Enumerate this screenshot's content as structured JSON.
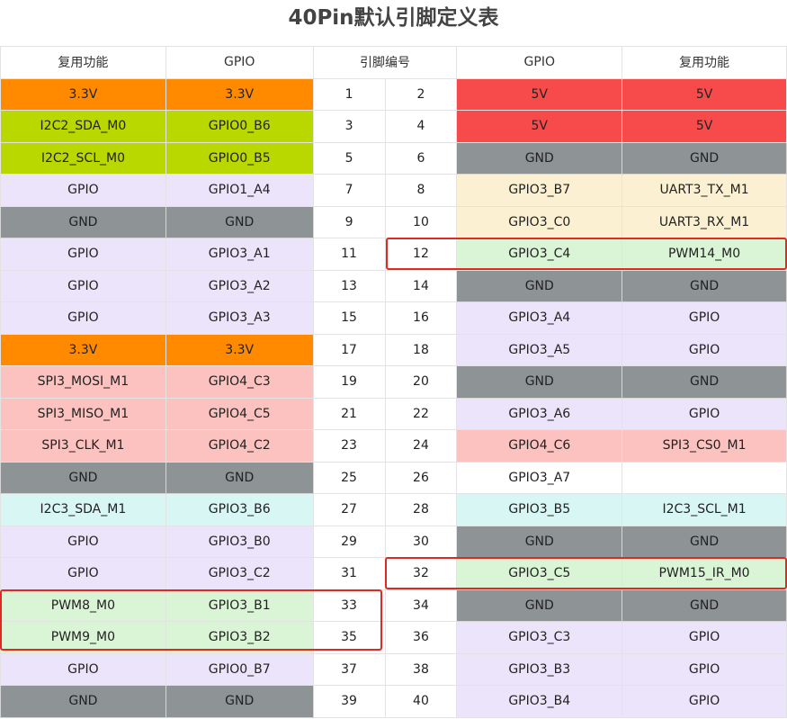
{
  "title": "40Pin默认引脚定义表",
  "headers": {
    "func_left": "复用功能",
    "gpio_left": "GPIO",
    "pin_no": "引脚编号",
    "gpio_right": "GPIO",
    "func_right": "复用功能"
  },
  "colors": {
    "orange": "#ff8a00",
    "green": "#b8d800",
    "red": "#f64b4a",
    "gray": "#8e9396",
    "lavender": "#ebe4fa",
    "cream": "#fbf1d2",
    "mint": "#daf5d5",
    "pink": "#fbc2bf",
    "cyan": "#d7f6f4",
    "white": "#ffffff",
    "highlight": "#e02a20"
  },
  "rows": [
    {
      "lf": "3.3V",
      "lg": "3.3V",
      "lc": "orange",
      "p1": "1",
      "p2": "2",
      "rg": "5V",
      "rf": "5V",
      "rc": "red"
    },
    {
      "lf": "I2C2_SDA_M0",
      "lg": "GPIO0_B6",
      "lc": "green",
      "p1": "3",
      "p2": "4",
      "rg": "5V",
      "rf": "5V",
      "rc": "red"
    },
    {
      "lf": "I2C2_SCL_M0",
      "lg": "GPIO0_B5",
      "lc": "green",
      "p1": "5",
      "p2": "6",
      "rg": "GND",
      "rf": "GND",
      "rc": "gray"
    },
    {
      "lf": "GPIO",
      "lg": "GPIO1_A4",
      "lc": "lavender",
      "p1": "7",
      "p2": "8",
      "rg": "GPIO3_B7",
      "rf": "UART3_TX_M1",
      "rc": "cream"
    },
    {
      "lf": "GND",
      "lg": "GND",
      "lc": "gray",
      "p1": "9",
      "p2": "10",
      "rg": "GPIO3_C0",
      "rf": "UART3_RX_M1",
      "rc": "cream"
    },
    {
      "lf": "GPIO",
      "lg": "GPIO3_A1",
      "lc": "lavender",
      "p1": "11",
      "p2": "12",
      "rg": "GPIO3_C4",
      "rf": "PWM14_M0",
      "rc": "mint"
    },
    {
      "lf": "GPIO",
      "lg": "GPIO3_A2",
      "lc": "lavender",
      "p1": "13",
      "p2": "14",
      "rg": "GND",
      "rf": "GND",
      "rc": "gray"
    },
    {
      "lf": "GPIO",
      "lg": "GPIO3_A3",
      "lc": "lavender",
      "p1": "15",
      "p2": "16",
      "rg": "GPIO3_A4",
      "rf": "GPIO",
      "rc": "lavender"
    },
    {
      "lf": "3.3V",
      "lg": "3.3V",
      "lc": "orange",
      "p1": "17",
      "p2": "18",
      "rg": "GPIO3_A5",
      "rf": "GPIO",
      "rc": "lavender"
    },
    {
      "lf": "SPI3_MOSI_M1",
      "lg": "GPIO4_C3",
      "lc": "pink",
      "p1": "19",
      "p2": "20",
      "rg": "GND",
      "rf": "GND",
      "rc": "gray"
    },
    {
      "lf": "SPI3_MISO_M1",
      "lg": "GPIO4_C5",
      "lc": "pink",
      "p1": "21",
      "p2": "22",
      "rg": "GPIO3_A6",
      "rf": "GPIO",
      "rc": "lavender"
    },
    {
      "lf": "SPI3_CLK_M1",
      "lg": "GPIO4_C2",
      "lc": "pink",
      "p1": "23",
      "p2": "24",
      "rg": "GPIO4_C6",
      "rf": "SPI3_CS0_M1",
      "rc": "pink"
    },
    {
      "lf": "GND",
      "lg": "GND",
      "lc": "gray",
      "p1": "25",
      "p2": "26",
      "rg": "GPIO3_A7",
      "rf": "",
      "rc": "white"
    },
    {
      "lf": "I2C3_SDA_M1",
      "lg": "GPIO3_B6",
      "lc": "cyan",
      "p1": "27",
      "p2": "28",
      "rg": "GPIO3_B5",
      "rf": "I2C3_SCL_M1",
      "rc": "cyan"
    },
    {
      "lf": "GPIO",
      "lg": "GPIO3_B0",
      "lc": "lavender",
      "p1": "29",
      "p2": "30",
      "rg": "GND",
      "rf": "GND",
      "rc": "gray"
    },
    {
      "lf": "GPIO",
      "lg": "GPIO3_C2",
      "lc": "lavender",
      "p1": "31",
      "p2": "32",
      "rg": "GPIO3_C5",
      "rf": "PWM15_IR_M0",
      "rc": "mint"
    },
    {
      "lf": "PWM8_M0",
      "lg": "GPIO3_B1",
      "lc": "mint",
      "p1": "33",
      "p2": "34",
      "rg": "GND",
      "rf": "GND",
      "rc": "gray"
    },
    {
      "lf": "PWM9_M0",
      "lg": "GPIO3_B2",
      "lc": "mint",
      "p1": "35",
      "p2": "36",
      "rg": "GPIO3_C3",
      "rf": "GPIO",
      "rc": "lavender"
    },
    {
      "lf": "GPIO",
      "lg": "GPIO0_B7",
      "lc": "lavender",
      "p1": "37",
      "p2": "38",
      "rg": "GPIO3_B3",
      "rf": "GPIO",
      "rc": "lavender"
    },
    {
      "lf": "GND",
      "lg": "GND",
      "lc": "gray",
      "p1": "39",
      "p2": "40",
      "rg": "GPIO3_B4",
      "rf": "GPIO",
      "rc": "lavender"
    }
  ]
}
